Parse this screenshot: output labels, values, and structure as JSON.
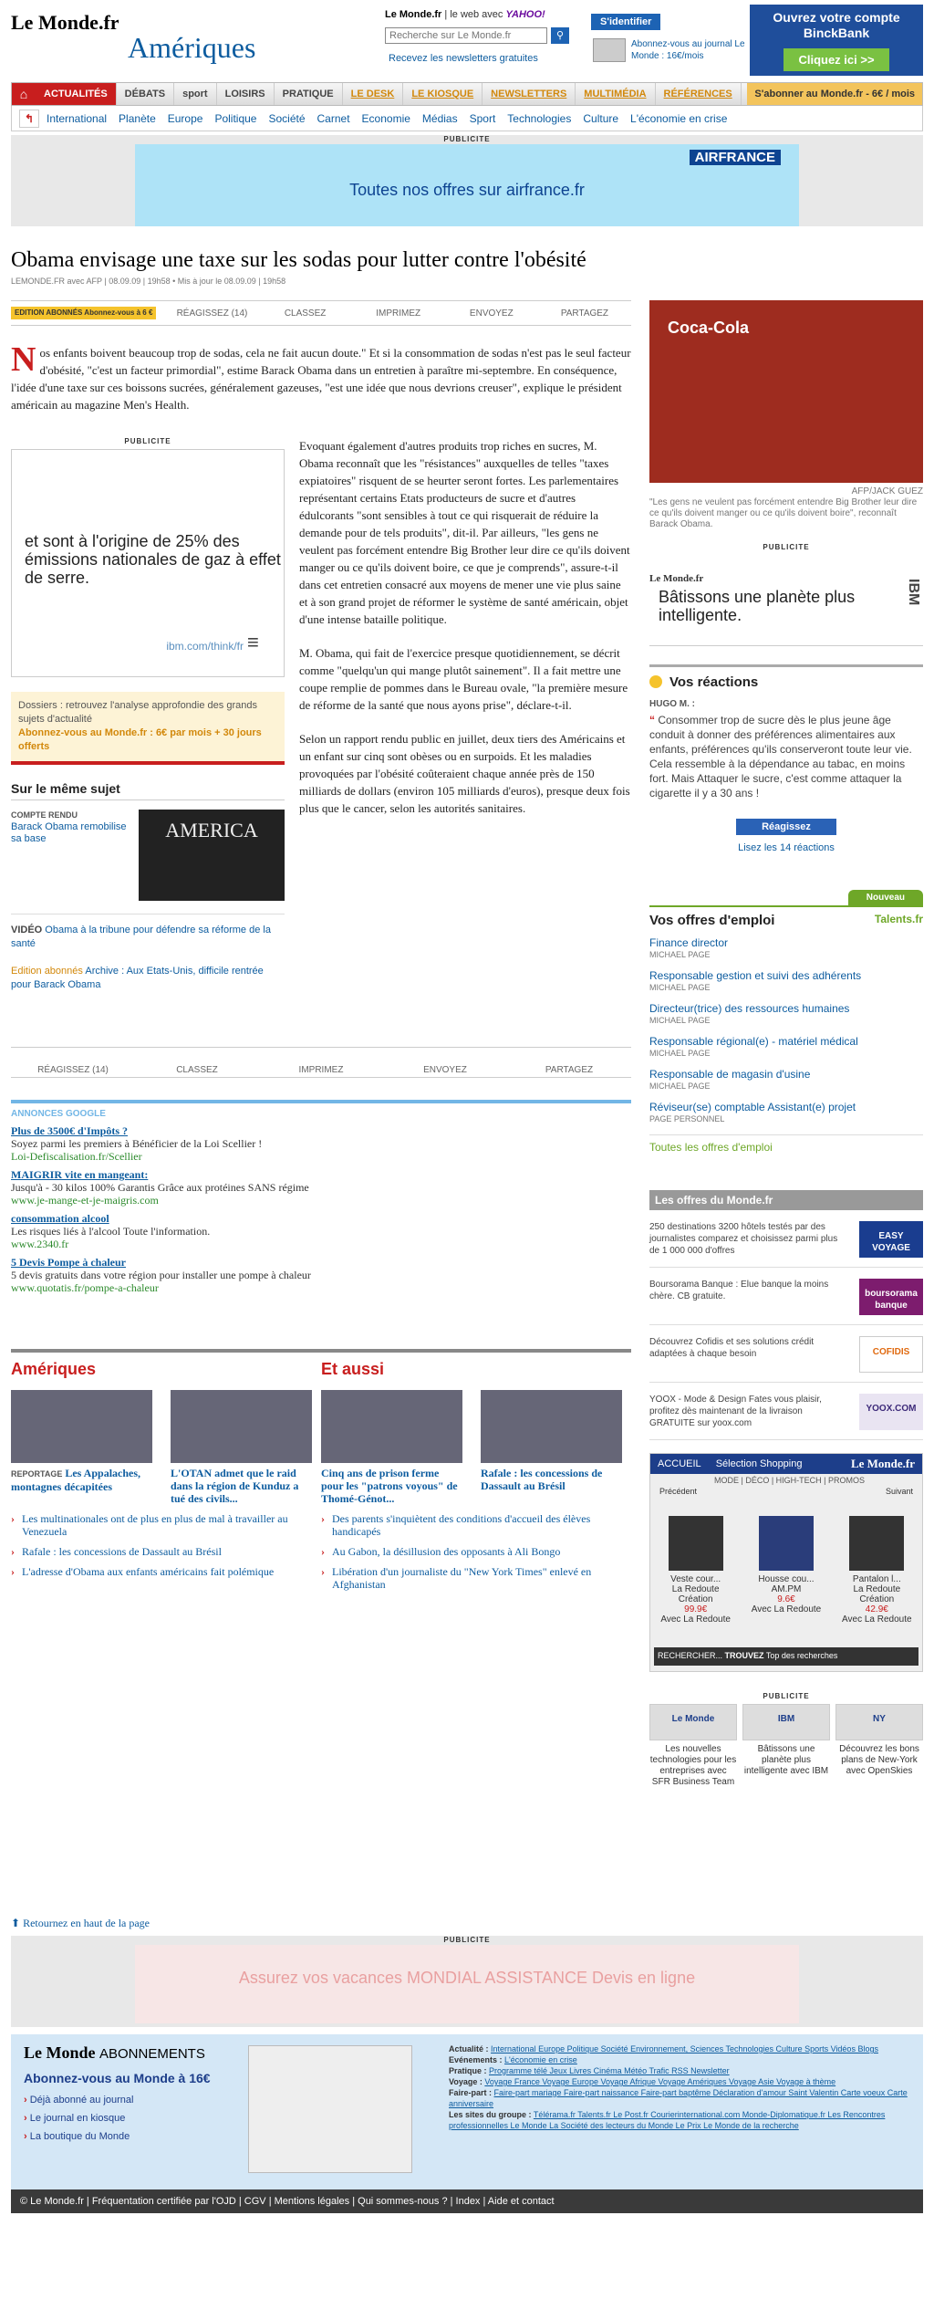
{
  "header": {
    "logo": "Le Monde.fr",
    "rubrique": "Amériques",
    "yahoo_prefix": "Le Monde.fr",
    "yahoo_mid": "| le web avec",
    "yahoo_brand": "YAHOO!",
    "search_placeholder": "Recherche sur Le Monde.fr",
    "newsletters": "Recevez les newsletters gratuites",
    "identify": "S'identifier",
    "abo_text": "Abonnez-vous au journal Le Monde : 16€/mois",
    "binck_text": "Ouvrez votre compte BinckBank",
    "binck_btn": "Cliquez ici >>"
  },
  "nav": {
    "items": [
      "ACTUALITÉS",
      "DÉBATS",
      "sport",
      "LOISIRS",
      "PRATIQUE"
    ],
    "orange": [
      "LE DESK",
      "LE KIOSQUE",
      "NEWSLETTERS",
      "MULTIMÉDIA",
      "RÉFÉRENCES"
    ],
    "sub": "S'abonner au Monde.fr - 6€ / mois"
  },
  "nav2": [
    "International",
    "Planète",
    "Europe",
    "Politique",
    "Société",
    "Carnet",
    "Economie",
    "Médias",
    "Sport",
    "Technologies",
    "Culture",
    "L'économie en crise"
  ],
  "pub": {
    "label": "PUBLICITE",
    "brand": "AIRFRANCE",
    "text": "Toutes nos offres sur airfrance.fr"
  },
  "article": {
    "title": "Obama envisage une taxe sur les sodas pour lutter contre l'obésité",
    "meta": "LEMONDE.FR avec AFP | 08.09.09 | 19h58  •  Mis à jour le 08.09.09 | 19h58",
    "tools": {
      "edition": "EDITION ABONNÉS Abonnez-vous à 6 €",
      "react": "RÉAGISSEZ (14)",
      "classez": "CLASSEZ",
      "imprimez": "IMPRIMEZ",
      "envoyez": "ENVOYEZ",
      "partagez": "PARTAGEZ"
    },
    "lead_initial": "N",
    "lead": "os enfants boivent beaucoup trop de sodas, cela ne fait aucun doute.\" Et si la consommation de sodas n'est pas le seul facteur d'obésité, \"c'est un facteur primordial\", estime Barack Obama dans un entretien à paraître mi-septembre. En conséquence, l'idée d'une taxe sur ces boissons sucrées, généralement gazeuses, \"est une idée que nous devrions creuser\", explique le président américain au magazine Men's Health.",
    "p1": "Evoquant également d'autres produits trop riches en sucres, M. Obama reconnaît que les \"résistances\" auxquelles de telles \"taxes expiatoires\" risquent de se heurter seront fortes. Les parlementaires représentant certains Etats producteurs de sucre et d'autres édulcorants \"sont sensibles à tout ce qui risquerait de réduire la demande pour de tels produits\", dit-il. Par ailleurs, \"les gens ne veulent pas forcément entendre Big Brother leur dire ce qu'ils doivent manger ou ce qu'ils doivent boire, ce que je comprends\", assure-t-il dans cet entretien consacré aux moyens de mener une vie plus saine et à son grand projet de réformer le système de santé américain, objet d'une intense bataille politique.",
    "p2": "M. Obama, qui fait de l'exercice presque quotidiennement, se décrit comme \"quelqu'un qui mange plutôt sainement\". Il a fait mettre une coupe remplie de pommes dans le Bureau ovale, \"la première mesure de réforme de la santé que nous ayons prise\", déclare-t-il.",
    "p3": "Selon un rapport rendu public en juillet, deux tiers des Américains et un enfant sur cinq sont obèses ou en surpoids. Et les maladies provoquées par l'obésité coûteraient chaque année près de 150 milliards de dollars (environ 105 milliards d'euros), presque deux fois plus que le cancer, selon les autorités sanitaires."
  },
  "ibm_ad": {
    "label": "PUBLICITE",
    "text": "et sont à l'origine de 25% des émissions nationales de gaz à effet de serre.",
    "url": "ibm.com/think/fr"
  },
  "dossier": {
    "text": "Dossiers : retrouvez l'analyse approfondie des grands sujets d'actualité",
    "promo": "Abonnez-vous au Monde.fr : 6€ par mois + 30 jours offerts"
  },
  "same": {
    "title": "Sur le même sujet",
    "kind": "COMPTE RENDU",
    "link": "Barack Obama remobilise sa base",
    "photo": "AMERICA",
    "video_label": "VIDÉO",
    "video": "Obama à la tribune pour défendre sa réforme de la santé",
    "ed": "Edition abonnés",
    "archive": "Archive : Aux Etats-Unis, difficile rentrée pour Barack Obama"
  },
  "photo": {
    "alt": "Coca-Cola",
    "credit": "AFP/JACK GUEZ",
    "caption": "\"Les gens ne veulent pas forcément entendre Big Brother leur dire ce qu'ils doivent manger ou ce qu'ils doivent boire\", reconnaît Barack Obama."
  },
  "ibm2": {
    "label": "PUBLICITE",
    "lm": "Le Monde.fr",
    "text": "Bâtissons une planète plus intelligente.",
    "logo": "IBM"
  },
  "reactions": {
    "title": "Vos réactions",
    "author": "HUGO M. :",
    "quote": "Consommer trop de sucre dès le plus jeune âge conduit à donner des préférences alimentaires aux enfants, préférences qu'ils conserveront toute leur vie. Cela ressemble à la dépendance au tabac, en moins fort. Mais Attaquer le sucre, c'est comme attaquer la cigarette il y a 30 ans !",
    "btn": "Réagissez",
    "all": "Lisez les 14 réactions"
  },
  "emploi": {
    "new": "Nouveau",
    "title": "Vos offres d'emploi",
    "brand": "Talents.fr",
    "jobs": [
      {
        "t": "Finance director",
        "c": "MICHAEL PAGE"
      },
      {
        "t": "Responsable gestion et suivi des adhérents",
        "c": "MICHAEL PAGE"
      },
      {
        "t": "Directeur(trice) des ressources humaines",
        "c": "MICHAEL PAGE"
      },
      {
        "t": "Responsable régional(e) - matériel médical",
        "c": "MICHAEL PAGE"
      },
      {
        "t": "Responsable de magasin d'usine",
        "c": "MICHAEL PAGE"
      },
      {
        "t": "Réviseur(se) comptable Assistant(e) projet",
        "c": "PAGE PERSONNEL"
      }
    ],
    "all": "Toutes les offres d'emploi"
  },
  "offres": {
    "title": "Les offres du Monde.fr",
    "items": [
      {
        "t": "250 destinations 3200 hôtels testés par des journalistes comparez et choisissez parmi plus de 1 000 000 d'offres",
        "lg": "EASY VOYAGE"
      },
      {
        "t": "Boursorama Banque : Elue banque la moins chère. CB gratuite.",
        "lg": "boursorama banque"
      },
      {
        "t": "Découvrez Cofidis et ses solutions crédit adaptées à chaque besoin",
        "lg": "COFIDIS"
      },
      {
        "t": "YOOX - Mode & Design Fates vous plaisir, profitez dès maintenant de la livraison GRATUITE sur yoox.com",
        "lg": "YOOX.COM"
      }
    ]
  },
  "shop": {
    "accueil": "ACCUEIL",
    "sel": "Sélection Shopping",
    "lm": "Le Monde.fr",
    "tabs": "MODE | DÉCO | HIGH-TECH | PROMOS",
    "prev": "Précédent",
    "next": "Suivant",
    "prods": [
      {
        "n": "Veste cour...",
        "s": "La Redoute",
        "c": "Création",
        "p": "99.9€",
        "v": "Avec La Redoute"
      },
      {
        "n": "Housse cou...",
        "s": "AM.PM",
        "c": "",
        "p": "9.6€",
        "v": "Avec La Redoute"
      },
      {
        "n": "Pantalon l...",
        "s": "La Redoute",
        "c": "Création",
        "p": "42.9€",
        "v": "Avec La Redoute"
      }
    ],
    "search": "RECHERCHER...",
    "trouvez": "TROUVEZ",
    "top": "Top des recherches"
  },
  "pubsm": {
    "label": "PUBLICITE",
    "cells": [
      {
        "im": "Le Monde",
        "t": "Les nouvelles technologies pour les entreprises avec SFR Business Team"
      },
      {
        "im": "IBM",
        "t": "Bâtissons une planète plus intelligente avec IBM"
      },
      {
        "im": "NY",
        "t": "Découvrez les bons plans de New-York avec OpenSkies"
      }
    ]
  },
  "google": {
    "title": "ANNONCES GOOGLE",
    "ads": [
      {
        "h": "Plus de 3500€ d'Impôts ?",
        "d": "Soyez parmi les premiers à Bénéficier de la Loi Scellier !",
        "u": "Loi-Defiscalisation.fr/Scellier"
      },
      {
        "h": "MAIGRIR vite en mangeant:",
        "d": "Jusqu'à - 30 kilos 100% Garantis Grâce aux protéines SANS régime",
        "u": "www.je-mange-et-je-maigris.com"
      },
      {
        "h": "consommation alcool",
        "d": "Les risques liés à l'alcool Toute l'information.",
        "u": "www.2340.fr"
      },
      {
        "h": "5 Devis Pompe à chaleur",
        "d": "5 devis gratuits dans votre région pour installer une pompe à chaleur",
        "u": "www.quotatis.fr/pompe-a-chaleur"
      }
    ]
  },
  "sections": [
    {
      "title": "Amériques",
      "cards": [
        {
          "k": "REPORTAGE",
          "t": "Les Appalaches, montagnes décapitées"
        },
        {
          "k": "",
          "t": "L'OTAN admet que le raid dans la région de Kunduz a tué des civils..."
        }
      ],
      "links": [
        "Les multinationales ont de plus en plus de mal à travailler au Venezuela",
        "Rafale : les concessions de Dassault au Brésil",
        "L'adresse d'Obama aux enfants américains fait polémique"
      ]
    },
    {
      "title": "Et aussi",
      "cards": [
        {
          "k": "",
          "t": "Cinq ans de prison ferme pour les \"patrons voyous\" de Thomé-Génot..."
        },
        {
          "k": "",
          "t": "Rafale : les concessions de Dassault au Brésil"
        }
      ],
      "links": [
        "Des parents s'inquiètent des conditions d'accueil des élèves handicapés",
        "Au Gabon, la désillusion des opposants à Ali Bongo",
        "Libération d'un journaliste du \"New York Times\" enlevé en Afghanistan"
      ]
    }
  ],
  "haut": "Retournez en haut de la page",
  "pub2": {
    "label": "PUBLICITE",
    "text": "Assurez vos vacances  MONDIAL ASSISTANCE  Devis en ligne"
  },
  "abonnements": {
    "lm": "Le Monde",
    "lm2": "ABONNEMENTS",
    "title": "Abonnez-vous au Monde à 16€",
    "links": [
      "Déjà abonné au journal",
      "Le journal en kiosque",
      "La boutique du Monde"
    ],
    "rows": [
      {
        "k": "Actualité :",
        "v": "International  Europe  Politique  Société  Environnement, Sciences  Technologies  Culture  Sports  Vidéos  Blogs"
      },
      {
        "k": "Evénements :",
        "v": "L'économie en crise"
      },
      {
        "k": "Pratique :",
        "v": "Programme télé  Jeux  Livres  Cinéma  Météo  Trafic  RSS  Newsletter"
      },
      {
        "k": "Voyage :",
        "v": "Voyage France  Voyage Europe  Voyage Afrique  Voyage Amériques  Voyage Asie  Voyage à thème"
      },
      {
        "k": "Faire-part :",
        "v": "Faire-part mariage  Faire-part naissance  Faire-part baptême  Déclaration d'amour  Saint Valentin  Carte voeux  Carte anniversaire"
      },
      {
        "k": "Les sites du groupe :",
        "v": "Télérama.fr  Talents.fr  Le Post.fr  Courierinternational.com  Monde-Diplomatique.fr  Les Rencontres professionnelles Le Monde  La Société des lecteurs du Monde  Le Prix Le Monde de la recherche"
      }
    ]
  },
  "footer": "© Le Monde.fr | Fréquentation certifiée par l'OJD | CGV | Mentions légales | Qui sommes-nous ? | Index | Aide et contact"
}
